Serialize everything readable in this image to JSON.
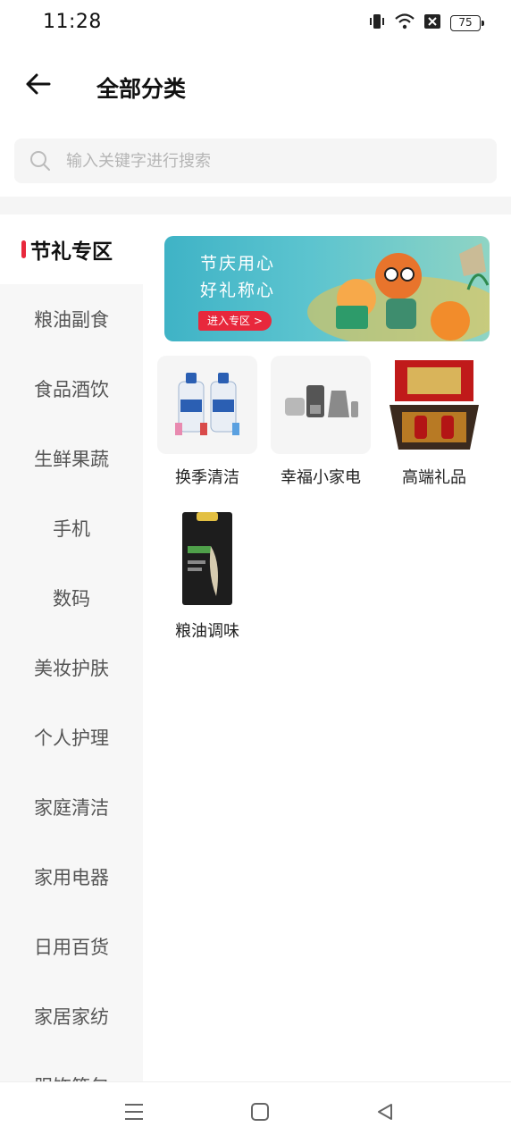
{
  "status": {
    "time": "11:28",
    "battery": "75",
    "icons": [
      "vibrate-icon",
      "wifi-icon",
      "no-sim-icon",
      "battery-icon"
    ]
  },
  "header": {
    "title": "全部分类",
    "back_icon": "back-arrow-icon"
  },
  "search": {
    "placeholder": "输入关键字进行搜索",
    "value": ""
  },
  "sidebar": {
    "items": [
      {
        "label": "节礼专区",
        "active": true
      },
      {
        "label": "粮油副食"
      },
      {
        "label": "食品酒饮"
      },
      {
        "label": "生鲜果蔬"
      },
      {
        "label": "手机"
      },
      {
        "label": "数码"
      },
      {
        "label": "美妆护肤"
      },
      {
        "label": "个人护理"
      },
      {
        "label": "家庭清洁"
      },
      {
        "label": "家用电器"
      },
      {
        "label": "日用百货"
      },
      {
        "label": "家居家纺"
      },
      {
        "label": "服饰箱包"
      }
    ]
  },
  "banner": {
    "line1": "节庆用心",
    "line2": "好礼称心",
    "button": "进入专区 >"
  },
  "categories": [
    {
      "label": "换季清洁"
    },
    {
      "label": "幸福小家电"
    },
    {
      "label": "高端礼品"
    },
    {
      "label": "粮油调味"
    }
  ],
  "colors": {
    "accent": "#e8283c",
    "sidebar_bg": "#f7f7f7",
    "banner_bg": "#4dbccb"
  }
}
